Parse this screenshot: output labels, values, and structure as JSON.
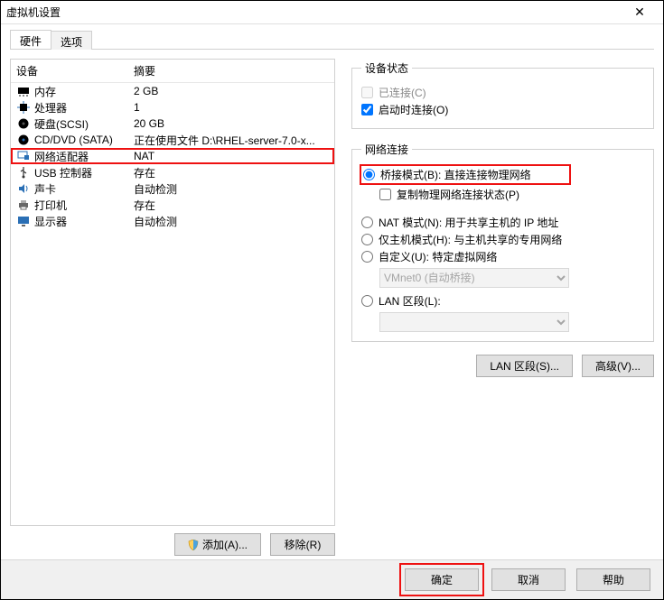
{
  "window": {
    "title": "虚拟机设置"
  },
  "tabs": {
    "hardware": "硬件",
    "options": "选项"
  },
  "table": {
    "header_device": "设备",
    "header_summary": "摘要",
    "rows": [
      {
        "icon": "memory-icon",
        "device": "内存",
        "summary": "2 GB"
      },
      {
        "icon": "cpu-icon",
        "device": "处理器",
        "summary": "1"
      },
      {
        "icon": "harddisk-icon",
        "device": "硬盘(SCSI)",
        "summary": "20 GB"
      },
      {
        "icon": "cd-icon",
        "device": "CD/DVD (SATA)",
        "summary": "正在使用文件 D:\\RHEL-server-7.0-x..."
      },
      {
        "icon": "network-icon",
        "device": "网络适配器",
        "summary": "NAT",
        "selected": true
      },
      {
        "icon": "usb-icon",
        "device": "USB 控制器",
        "summary": "存在"
      },
      {
        "icon": "sound-icon",
        "device": "声卡",
        "summary": "自动检测"
      },
      {
        "icon": "printer-icon",
        "device": "打印机",
        "summary": "存在"
      },
      {
        "icon": "display-icon",
        "device": "显示器",
        "summary": "自动检测"
      }
    ]
  },
  "left_buttons": {
    "add": "添加(A)...",
    "remove": "移除(R)"
  },
  "device_status": {
    "legend": "设备状态",
    "connected": "已连接(C)",
    "connect_on_power": "启动时连接(O)"
  },
  "net_conn": {
    "legend": "网络连接",
    "bridged": "桥接模式(B): 直接连接物理网络",
    "replicate": "复制物理网络连接状态(P)",
    "nat": "NAT 模式(N): 用于共享主机的 IP 地址",
    "hostonly": "仅主机模式(H): 与主机共享的专用网络",
    "custom": "自定义(U): 特定虚拟网络",
    "custom_value": "VMnet0 (自动桥接)",
    "lan": "LAN 区段(L):",
    "lan_value": ""
  },
  "right_buttons": {
    "lan_seg": "LAN 区段(S)...",
    "advanced": "高级(V)..."
  },
  "bottom": {
    "ok": "确定",
    "cancel": "取消",
    "help": "帮助"
  }
}
